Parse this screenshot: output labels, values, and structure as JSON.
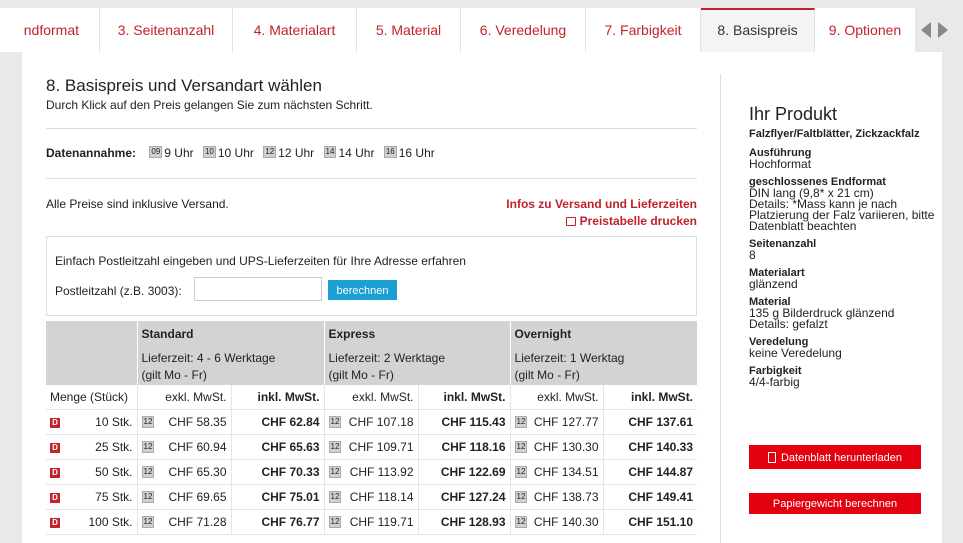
{
  "tabs": [
    {
      "label": "ndformat"
    },
    {
      "label": "3. Seitenanzahl"
    },
    {
      "label": "4. Materialart"
    },
    {
      "label": "5. Material"
    },
    {
      "label": "6. Veredelung"
    },
    {
      "label": "7. Farbigkeit"
    },
    {
      "label": "8. Basispreis"
    },
    {
      "label": "9. Optionen"
    }
  ],
  "main": {
    "title": "8. Basispreis und Versandart wählen",
    "subtitle": "Durch Klick auf den Preis gelangen Sie zum nächsten Schritt.",
    "datenannahme_label": "Datenannahme:",
    "times": [
      {
        "badge": "09",
        "label": "9 Uhr"
      },
      {
        "badge": "10",
        "label": "10 Uhr"
      },
      {
        "badge": "12",
        "label": "12 Uhr"
      },
      {
        "badge": "14",
        "label": "14 Uhr"
      },
      {
        "badge": "16",
        "label": "16 Uhr"
      }
    ],
    "prices_note": "Alle Preise sind inklusive Versand.",
    "infos_link": "Infos zu Versand und Lieferzeiten",
    "print_link": "Preistabelle drucken",
    "post_text": "Einfach Postleitzahl eingeben und UPS-Lieferzeiten für Ihre Adresse erfahren",
    "post_label": "Postleitzahl (z.B. 3003):",
    "post_value": "",
    "post_button": "berechnen"
  },
  "table": {
    "groups": [
      {
        "title": "Standard",
        "sub1": "Lieferzeit: 4 - 6 Werktage",
        "sub2": "(gilt Mo - Fr)"
      },
      {
        "title": "Express",
        "sub1": "Lieferzeit: 2 Werktage",
        "sub2": "(gilt Mo - Fr)"
      },
      {
        "title": "Overnight",
        "sub1": "Lieferzeit: 1 Werktag",
        "sub2": "(gilt Mo - Fr)"
      }
    ],
    "col_qty": "Menge (Stück)",
    "col_excl": "exkl. MwSt.",
    "col_incl": "inkl. MwSt.",
    "badge": "D",
    "cell_badge": "12",
    "rows": [
      {
        "qty": "10 Stk.",
        "p": [
          "CHF 58.35",
          "CHF 62.84",
          "CHF 107.18",
          "CHF 115.43",
          "CHF 127.77",
          "CHF 137.61"
        ]
      },
      {
        "qty": "25 Stk.",
        "p": [
          "CHF 60.94",
          "CHF 65.63",
          "CHF 109.71",
          "CHF 118.16",
          "CHF 130.30",
          "CHF 140.33"
        ]
      },
      {
        "qty": "50 Stk.",
        "p": [
          "CHF 65.30",
          "CHF 70.33",
          "CHF 113.92",
          "CHF 122.69",
          "CHF 134.51",
          "CHF 144.87"
        ]
      },
      {
        "qty": "75 Stk.",
        "p": [
          "CHF 69.65",
          "CHF 75.01",
          "CHF 118.14",
          "CHF 127.24",
          "CHF 138.73",
          "CHF 149.41"
        ]
      },
      {
        "qty": "100 Stk.",
        "p": [
          "CHF 71.28",
          "CHF 76.77",
          "CHF 119.71",
          "CHF 128.93",
          "CHF 140.30",
          "CHF 151.10"
        ]
      }
    ]
  },
  "sidebar": {
    "title": "Ihr Produkt",
    "product": "Falzflyer/Faltblätter, Zickzackfalz",
    "attrs": [
      {
        "k": "Ausführung",
        "v": "Hochformat"
      },
      {
        "k": "geschlossenes Endformat",
        "v": "DIN lang (9,8* x 21 cm)\nDetails: *Mass kann je nach Platzierung der Falz variieren, bitte Datenblatt beachten"
      },
      {
        "k": "Seitenanzahl",
        "v": "8"
      },
      {
        "k": "Materialart",
        "v": "glänzend"
      },
      {
        "k": "Material",
        "v": "135 g Bilderdruck glänzend\nDetails: gefalzt"
      },
      {
        "k": "Veredelung",
        "v": "keine Veredelung"
      },
      {
        "k": "Farbigkeit",
        "v": "4/4-farbig"
      }
    ],
    "btn_datenblatt": "Datenblatt herunterladen",
    "btn_papier": "Papiergewicht berechnen"
  },
  "colors": {
    "accent": "#c1222b",
    "button_red": "#e3000f",
    "button_blue": "#1a9ed3"
  }
}
